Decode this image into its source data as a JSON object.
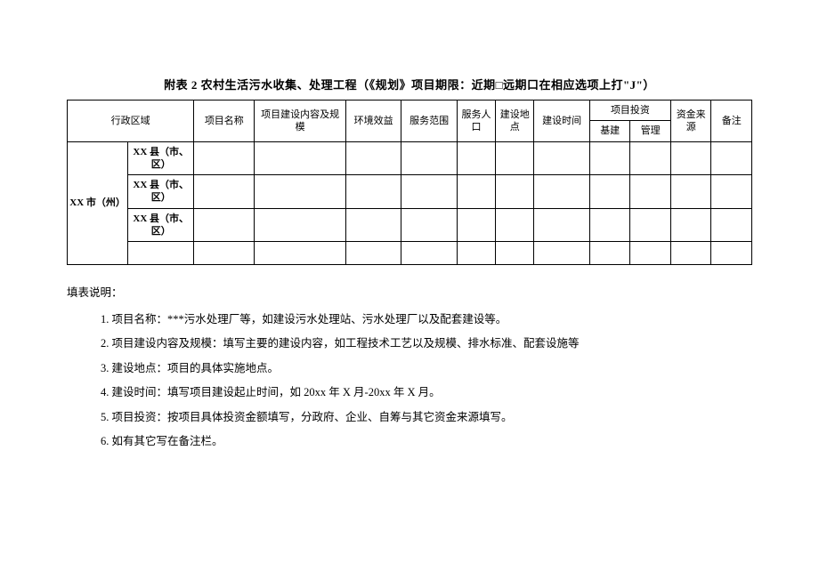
{
  "title": "附表 2 农村生活污水收集、处理工程（《规划》项目期限：近期□远期口在相应选项上打\"J\"）",
  "headers": {
    "region": "行政区域",
    "projectName": "项目名称",
    "projectContent": "项目建设内容及规模",
    "envBenefit": "环境效益",
    "serviceScope": "服务范围",
    "servicePop": "服务人口",
    "buildLoc": "建设地点",
    "buildTime": "建设时间",
    "investment": "项目投资",
    "investSub1": "基建",
    "investSub2": "管理",
    "fundSource": "资金来源",
    "remark": "备注"
  },
  "rows": {
    "cityLabel": "XX 市（州）",
    "county1": "XX 县（市、区）",
    "county2": "XX 县（市、区）",
    "county3": "XX 县（市、区）"
  },
  "instructions": {
    "heading": "填表说明：",
    "items": [
      "1. 项目名称：***污水处理厂等，如建设污水处理站、污水处理厂以及配套建设等。",
      "2. 项目建设内容及规模：填写主要的建设内容，如工程技术工艺以及规模、排水标准、配套设施等",
      "3. 建设地点：项目的具体实施地点。",
      "4. 建设时间：填写项目建设起止时间，如 20xx 年 X 月-20xx 年 X 月。",
      "5. 项目投资：按项目具体投资金额填写，分政府、企业、自筹与其它资金来源填写。",
      "6. 如有其它写在备注栏。"
    ]
  }
}
